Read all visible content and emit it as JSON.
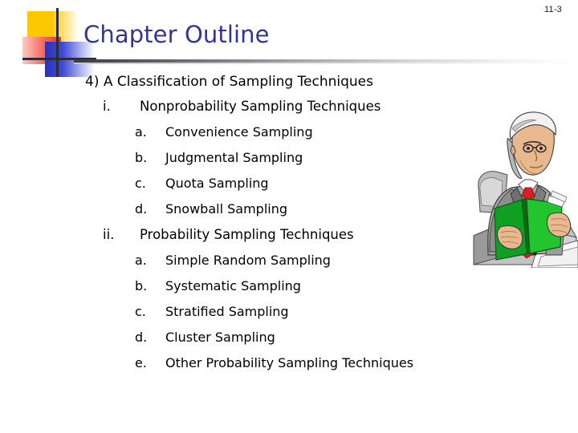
{
  "page_number": "11-3",
  "header": {
    "title": "Chapter Outline",
    "title_color": "#333399",
    "logo": {
      "name": "powerpoint-template-logo",
      "yellow": "#fec800",
      "red": "#e8342a",
      "blue": "#2b32b8",
      "line": "#2b2b3a"
    }
  },
  "outline": {
    "heading": "4) A Classification of Sampling Techniques",
    "sections": [
      {
        "marker": "i.",
        "label": "Nonprobability Sampling Techniques",
        "items": [
          {
            "marker": "a.",
            "label": "Convenience Sampling"
          },
          {
            "marker": "b.",
            "label": "Judgmental Sampling"
          },
          {
            "marker": "c.",
            "label": "Quota Sampling"
          },
          {
            "marker": "d.",
            "label": "Snowball Sampling"
          }
        ]
      },
      {
        "marker": "ii.",
        "label": "Probability Sampling Techniques",
        "items": [
          {
            "marker": "a.",
            "label": "Simple Random Sampling"
          },
          {
            "marker": "b.",
            "label": "Systematic Sampling"
          },
          {
            "marker": "c.",
            "label": "Stratified Sampling"
          },
          {
            "marker": "d.",
            "label": "Cluster Sampling"
          },
          {
            "marker": "e.",
            "label": "Other Probability Sampling Techniques"
          }
        ]
      }
    ]
  },
  "clipart": {
    "name": "businessman-reading-folder-clipart",
    "description": "Businessman in gray suit with red tie reading a green folder at a podium",
    "colors": {
      "suit": "#a8a8a8",
      "suit_dark": "#6f6f6f",
      "tie": "#d91f26",
      "folder": "#0fa021",
      "folder_light": "#22c52e",
      "skin": "#e8b98f",
      "hair": "#d8d8d8",
      "podium": "#b4b4b4",
      "paper": "#ffffff"
    }
  }
}
